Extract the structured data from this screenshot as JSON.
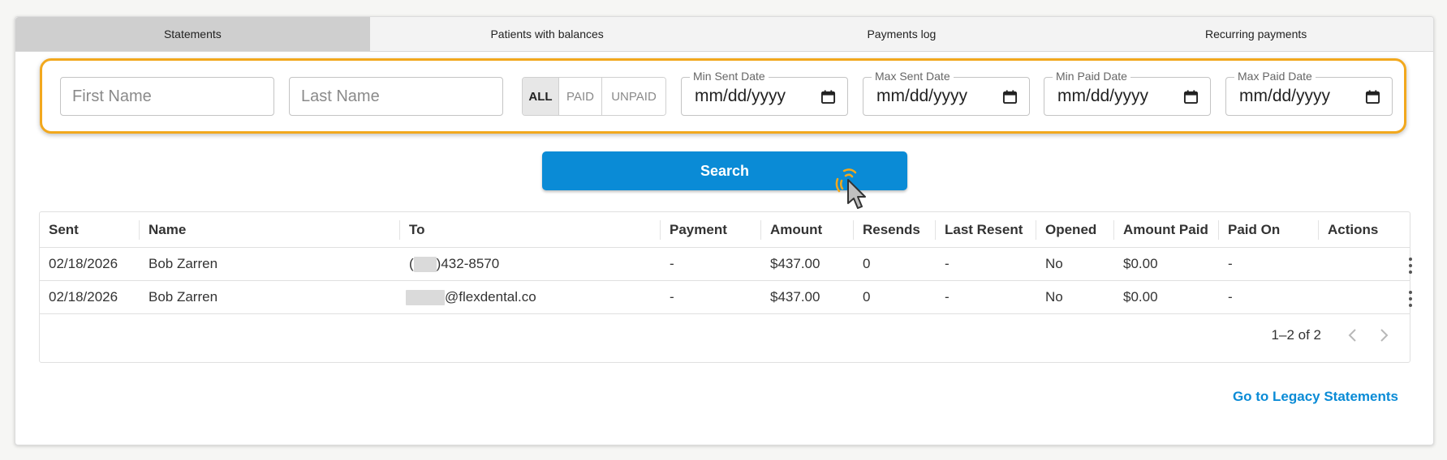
{
  "tabs": [
    {
      "label": "Statements",
      "active": true
    },
    {
      "label": "Patients with balances",
      "active": false
    },
    {
      "label": "Payments log",
      "active": false
    },
    {
      "label": "Recurring payments",
      "active": false
    }
  ],
  "filters": {
    "first_name_placeholder": "First Name",
    "last_name_placeholder": "Last Name",
    "status_options": [
      "ALL",
      "PAID",
      "UNPAID"
    ],
    "status_selected": "ALL",
    "min_sent_label": "Min Sent Date",
    "max_sent_label": "Max Sent Date",
    "min_paid_label": "Min Paid Date",
    "max_paid_label": "Max Paid Date",
    "date_placeholder": "mm/dd/yyyy"
  },
  "search": {
    "label": "Search"
  },
  "table": {
    "columns": [
      "Sent",
      "Name",
      "To",
      "Payment",
      "Amount",
      "Resends",
      "Last Resent",
      "Opened",
      "Amount Paid",
      "Paid On",
      "Actions"
    ],
    "rows": [
      {
        "sent": "02/18/2026",
        "name": "Bob Zarren",
        "to_prefix": "(",
        "to_suffix": ")432-8570",
        "payment": "-",
        "amount": "$437.00",
        "resends": "0",
        "last_resent": "-",
        "opened": "No",
        "amount_paid": "$0.00",
        "paid_on": "-"
      },
      {
        "sent": "02/18/2026",
        "name": "Bob Zarren",
        "to_prefix": "",
        "to_suffix": "@flexdental.co",
        "payment": "-",
        "amount": "$437.00",
        "resends": "0",
        "last_resent": "-",
        "opened": "No",
        "amount_paid": "$0.00",
        "paid_on": "-"
      }
    ],
    "pagination": "1–2 of 2"
  },
  "legacy_link": "Go to Legacy Statements",
  "colors": {
    "accent": "#0a8bd6",
    "highlight": "#f2a81d"
  },
  "icons": [
    "calendar-icon",
    "chevron-left-icon",
    "chevron-right-icon",
    "more-vertical-icon",
    "pointer-cursor-icon"
  ]
}
